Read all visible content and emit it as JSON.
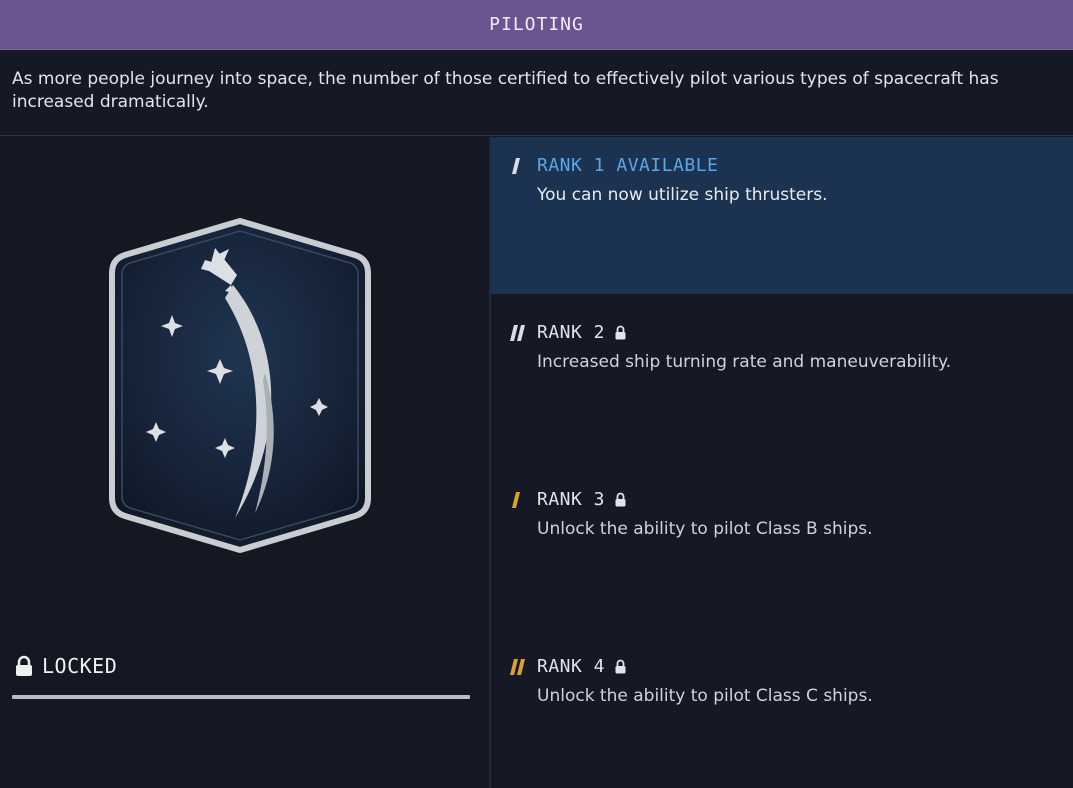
{
  "header": {
    "title": "PILOTING"
  },
  "description": "As more people journey into space, the number of those certified to effectively pilot various types of spacecraft has increased dramatically.",
  "skill": {
    "badge_icon": "piloting-patch-icon",
    "status_icon": "lock-icon",
    "status_label": "LOCKED",
    "progress": 0
  },
  "ranks": [
    {
      "title": "RANK 1 AVAILABLE",
      "description": "You can now utilize ship thrusters.",
      "state": "available",
      "bar_color": "#d9dce0",
      "locked": false
    },
    {
      "title": "RANK 2",
      "description": "Increased ship turning rate and maneuverability.",
      "state": "locked",
      "bar_color": "#d9dce0",
      "locked": true
    },
    {
      "title": "RANK 3",
      "description": "Unlock the ability to pilot Class B ships.",
      "state": "locked",
      "bar_color": "#e0a030",
      "locked": true
    },
    {
      "title": "RANK 4",
      "description": "Unlock the ability to pilot Class C ships.",
      "state": "locked",
      "bar_color": "#e0a030",
      "locked": true
    }
  ],
  "colors": {
    "header_bg": "#6b548f",
    "panel_bg": "#141925",
    "active_rank_bg": "#1b3350",
    "available_text": "#5aa6e8",
    "rank_accent_gold": "#e0a030"
  }
}
